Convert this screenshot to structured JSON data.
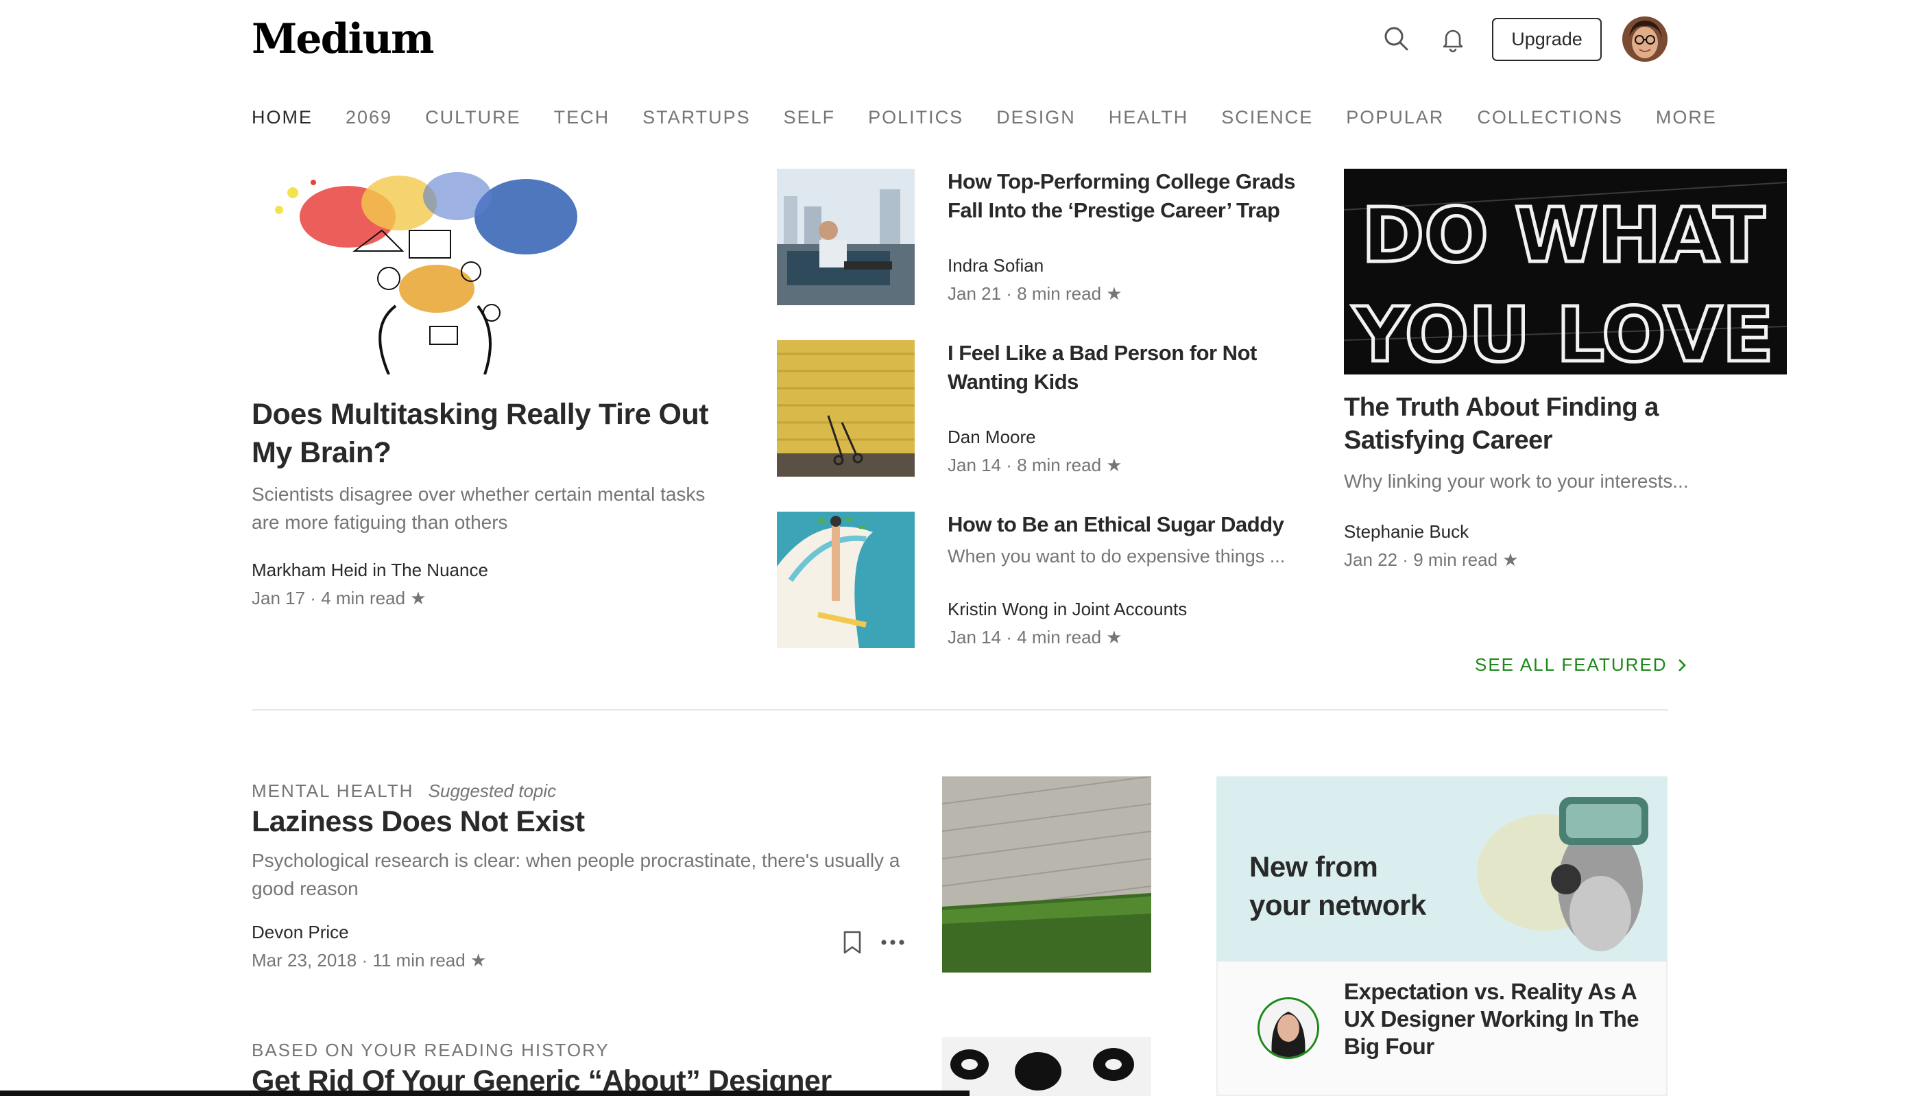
{
  "header": {
    "logo": "Medium",
    "upgrade_label": "Upgrade",
    "icons": [
      "search-icon",
      "bell-icon"
    ]
  },
  "nav": {
    "items": [
      "HOME",
      "2069",
      "CULTURE",
      "TECH",
      "STARTUPS",
      "SELF",
      "POLITICS",
      "DESIGN",
      "HEALTH",
      "SCIENCE",
      "POPULAR",
      "COLLECTIONS",
      "MORE"
    ],
    "active": "HOME"
  },
  "featured": {
    "main": {
      "title": "Does Multitasking Really Tire Out My Brain?",
      "subtitle": "Scientists disagree over whether certain mental tasks are more fatiguing than others",
      "author": "Markham Heid in The Nuance",
      "date": "Jan 17",
      "read": "4 min read"
    },
    "list": [
      {
        "title": "How Top-Performing College Grads Fall Into the ‘Prestige Career’ Trap",
        "subtitle": "",
        "author": "Indra Sofian",
        "date": "Jan 21",
        "read": "8 min read"
      },
      {
        "title": "I Feel Like a Bad Person for Not Wanting Kids",
        "subtitle": "",
        "author": "Dan Moore",
        "date": "Jan 14",
        "read": "8 min read"
      },
      {
        "title": "How to Be an Ethical Sugar Daddy",
        "subtitle": "When you want to do expensive things ...",
        "author": "Kristin Wong in Joint Accounts",
        "date": "Jan 14",
        "read": "4 min read"
      }
    ],
    "right": {
      "title": "The Truth About Finding a Satisfying Career",
      "subtitle": "Why linking your work to your interests...",
      "author": "Stephanie Buck",
      "date": "Jan 22",
      "read": "9 min read",
      "image_text": [
        "DO WHAT",
        "YOU LOVE"
      ]
    },
    "see_all": "SEE ALL FEATURED"
  },
  "feed": [
    {
      "topic": "MENTAL HEALTH",
      "topic_note": "Suggested topic",
      "title": "Laziness Does Not Exist",
      "subtitle": "Psychological research is clear: when people procrastinate, there's usually a good reason",
      "author": "Devon Price",
      "date": "Mar 23, 2018",
      "read": "11 min read"
    },
    {
      "topic": "BASED ON YOUR READING HISTORY",
      "title": "Get Rid Of Your Generic “About” Designer"
    }
  ],
  "sidebar": {
    "heading_line1": "New from",
    "heading_line2": "your network",
    "story_title": "Expectation vs. Reality As A UX Designer Working In The Big Four"
  },
  "colors": {
    "accent_green": "#1a8917",
    "text": "#292929",
    "muted": "#757575",
    "network_bg": "#dbeeef"
  }
}
